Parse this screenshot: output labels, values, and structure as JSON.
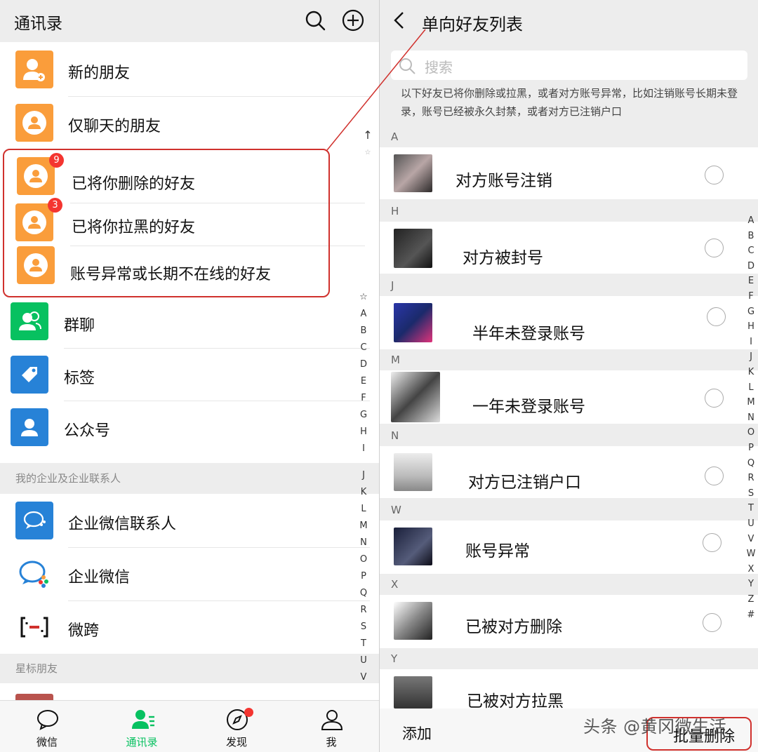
{
  "left": {
    "title": "通讯录",
    "top_items": [
      {
        "label": "新的朋友"
      },
      {
        "label": "仅聊天的朋友"
      }
    ],
    "highlight_items": [
      {
        "label": "已将你删除的好友",
        "badge": "9"
      },
      {
        "label": "已将你拉黑的好友",
        "badge": "3"
      },
      {
        "label": "账号异常或长期不在线的好友"
      }
    ],
    "feature_items": [
      {
        "label": "群聊"
      },
      {
        "label": "标签"
      },
      {
        "label": "公众号"
      }
    ],
    "enterprise_section": "我的企业及企业联系人",
    "enterprise_items": [
      {
        "label": "企业微信联系人"
      },
      {
        "label": "企业微信"
      },
      {
        "label": "微跨"
      }
    ],
    "starred_section": "星标朋友",
    "index_letters": [
      "☆",
      "A",
      "B",
      "C",
      "D",
      "E",
      "F",
      "G",
      "H",
      "I",
      "J",
      "K",
      "L",
      "M",
      "N",
      "O",
      "P",
      "Q",
      "R",
      "S",
      "T",
      "U",
      "V"
    ],
    "tabs": [
      {
        "label": "微信",
        "icon": "chat-bubble-icon"
      },
      {
        "label": "通讯录",
        "icon": "contacts-icon"
      },
      {
        "label": "发现",
        "icon": "compass-icon"
      },
      {
        "label": "我",
        "icon": "person-icon"
      }
    ],
    "active_color": "#07c160"
  },
  "right": {
    "title": "单向好友列表",
    "search_placeholder": "搜索",
    "notice": "以下好友已将你删除或拉黑，或者对方账号异常，比如注销账号长期未登录，账号已经被永久封禁，或者对方已注销户口",
    "groups": [
      {
        "letter": "A",
        "name": "对方账号注销"
      },
      {
        "letter": "H",
        "name": "对方被封号"
      },
      {
        "letter": "J",
        "name": "半年未登录账号"
      },
      {
        "letter": "M",
        "name": "一年未登录账号"
      },
      {
        "letter": "N",
        "name": "对方已注销户口"
      },
      {
        "letter": "W",
        "name": "账号异常"
      },
      {
        "letter": "X",
        "name": "已被对方删除"
      },
      {
        "letter": "Y",
        "name": "已被对方拉黑"
      }
    ],
    "index_letters": [
      "A",
      "B",
      "C",
      "D",
      "E",
      "F",
      "G",
      "H",
      "I",
      "J",
      "K",
      "L",
      "M",
      "N",
      "O",
      "P",
      "Q",
      "R",
      "S",
      "T",
      "U",
      "V",
      "W",
      "X",
      "Y",
      "Z",
      "#"
    ],
    "add_label": "添加",
    "bulk_delete_label": "批量删除",
    "watermark": "头条 @黄冈微生活"
  }
}
